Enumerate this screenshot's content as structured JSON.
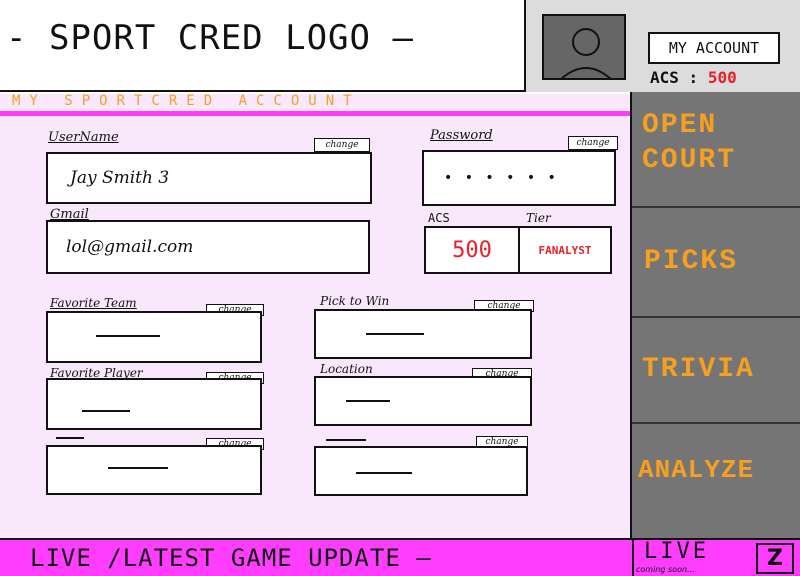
{
  "header": {
    "logo_text": "- SPORT CRED LOGO —",
    "my_account_label": "MY ACCOUNT",
    "acs_label": "ACS :",
    "acs_value": "500",
    "avatar_icon": "user-avatar-icon"
  },
  "page": {
    "title": "MY SPORTCRED ACCOUNT"
  },
  "form": {
    "username": {
      "label": "UserName",
      "value": "Jay Smith 3",
      "change_label": "change"
    },
    "password": {
      "label": "Password",
      "value": "• • • • • •",
      "change_label": "change"
    },
    "email": {
      "label": "Gmail",
      "value": "lol@gmail.com"
    },
    "acs": {
      "label": "ACS",
      "value": "500"
    },
    "tier": {
      "label": "Tier",
      "value": "FANALYST"
    },
    "favorite_team": {
      "label": "Favorite Team",
      "change_label": "change"
    },
    "pick_to_win": {
      "label": "Pick to Win",
      "change_label": "change"
    },
    "favorite_player": {
      "label": "Favorite Player",
      "change_label": "change"
    },
    "location": {
      "label": "Location",
      "change_label": "change"
    },
    "extra_left": {
      "label": "",
      "change_label": "change"
    },
    "extra_right": {
      "label": "",
      "change_label": "change"
    }
  },
  "sidebar": {
    "items": [
      {
        "label": "OPEN COURT"
      },
      {
        "label": "PICKS"
      },
      {
        "label": "TRIVIA"
      },
      {
        "label": "ANALYZE"
      }
    ]
  },
  "footer": {
    "ticker_text": "LIVE /LATEST GAME UPDATE —",
    "live_label": "LIVE",
    "live_sub": "coming soon...",
    "z_label": "Z"
  },
  "colors": {
    "pink_bar": "#ff3dff",
    "panel_bg": "#f9e8fb",
    "sidebar_bg": "#757575",
    "accent_orange": "#f5a020",
    "value_red": "#e8202a"
  }
}
